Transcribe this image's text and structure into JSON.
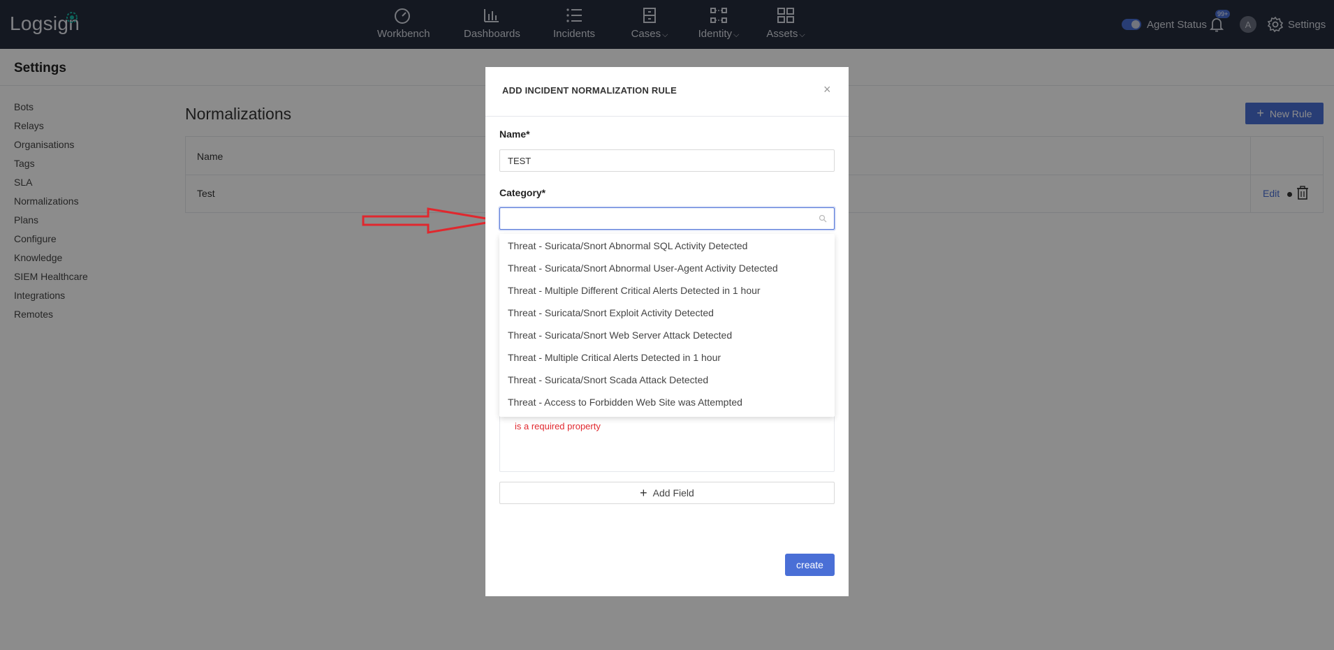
{
  "topbar": {
    "logo_text": "Logsign",
    "nav": [
      {
        "label": "Workbench",
        "icon": "gauge-icon"
      },
      {
        "label": "Dashboards",
        "icon": "bar-chart-icon"
      },
      {
        "label": "Incidents",
        "icon": "list-icon"
      },
      {
        "label": "Cases",
        "icon": "cabinet-icon",
        "has_dropdown": true
      },
      {
        "label": "Identity",
        "icon": "network-nodes-icon",
        "has_dropdown": true
      },
      {
        "label": "Assets",
        "icon": "grid-icon",
        "has_dropdown": true
      }
    ],
    "chevron_glyph": "⌵",
    "agent_status_label": "Agent Status",
    "notification_badge": "99+",
    "avatar_initial": "A",
    "settings_label": "Settings"
  },
  "page": {
    "title": "Settings"
  },
  "sidebar": {
    "items": [
      "Bots",
      "Relays",
      "Organisations",
      "Tags",
      "SLA",
      "Normalizations",
      "Plans",
      "Configure",
      "Knowledge",
      "SIEM Healthcare",
      "Integrations",
      "Remotes"
    ]
  },
  "main": {
    "title": "Normalizations",
    "new_rule_label": "New Rule",
    "new_rule_glyph": "+",
    "table": {
      "headers": [
        "Name"
      ],
      "rows": [
        {
          "name": "Test",
          "edit_label": "Edit"
        }
      ]
    }
  },
  "modal": {
    "title": "ADD INCIDENT NORMALIZATION RULE",
    "close_glyph": "×",
    "name_label": "Name*",
    "name_value": "TEST",
    "category_label": "Category*",
    "category_value": "",
    "error_text": "is a required property",
    "add_field_label": "Add Field",
    "add_field_glyph": "+",
    "create_label": "create"
  },
  "dropdown": {
    "options": [
      "Threat - Suricata/Snort Abnormal SQL Activity Detected",
      "Threat - Suricata/Snort Abnormal User-Agent Activity Detected",
      "Threat - Multiple Different Critical Alerts Detected in 1 hour",
      "Threat - Suricata/Snort Exploit Activity Detected",
      "Threat - Suricata/Snort Web Server Attack Detected",
      "Threat - Multiple Critical Alerts Detected in 1 hour",
      "Threat - Suricata/Snort Scada Attack Detected",
      "Threat - Access to Forbidden Web Site was Attempted"
    ]
  },
  "colors": {
    "topbar": "#262c3c",
    "accent": "#4a6fd6",
    "error": "#e0282e",
    "annotation_arrow": "#e0282e"
  }
}
